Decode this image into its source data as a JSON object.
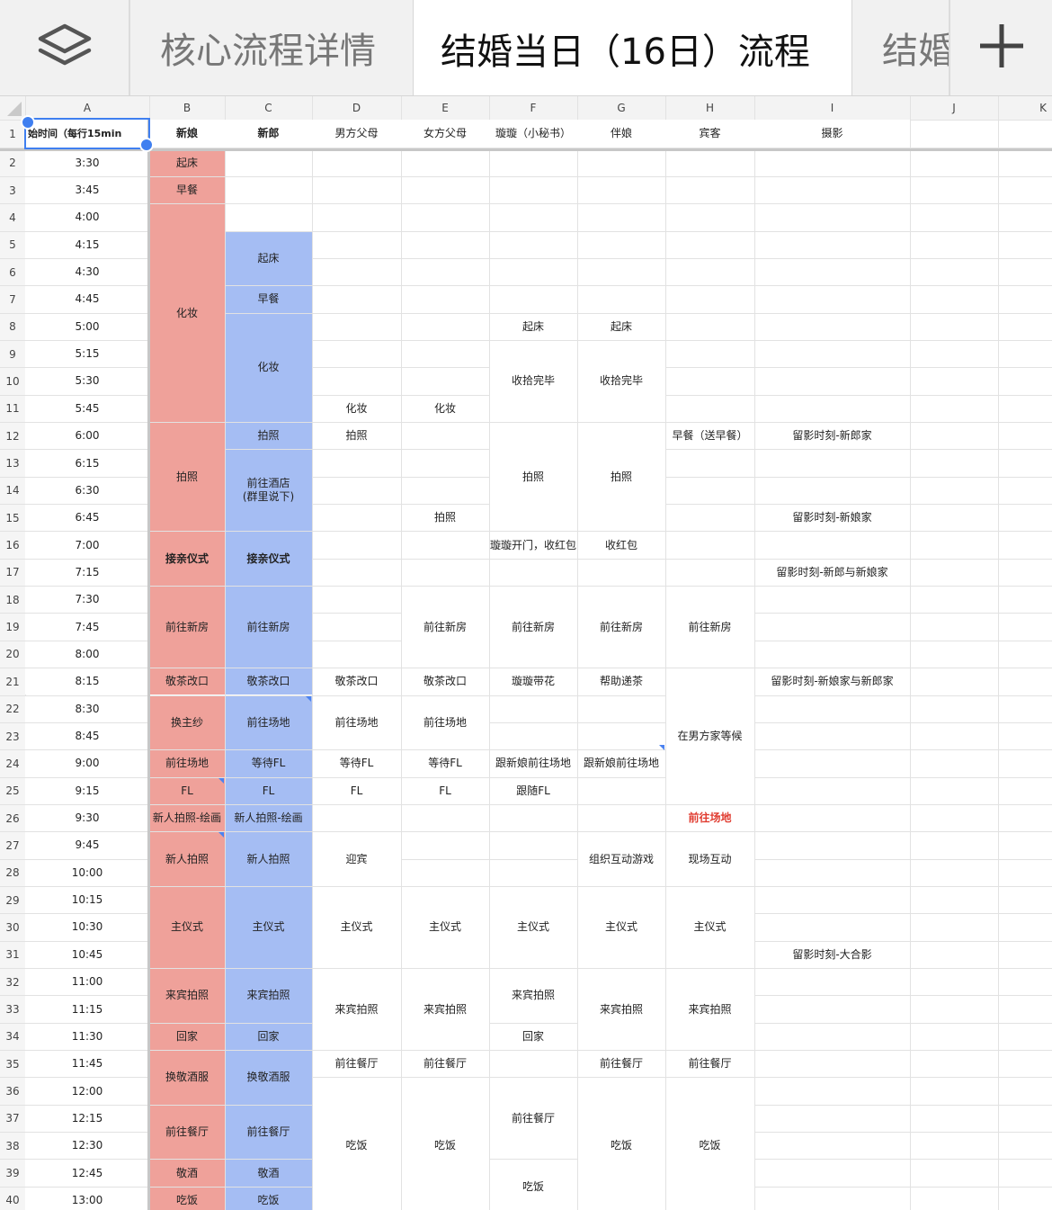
{
  "tabs": {
    "items": [
      {
        "label": "核心流程详情"
      },
      {
        "label": "结婚当日（16日）流程"
      },
      {
        "label": "结婚"
      }
    ],
    "active_index": 1,
    "layers_icon": "layers-icon",
    "add_icon": "plus-icon"
  },
  "colors": {
    "bride": "#efa19a",
    "groom": "#a5bdf3",
    "grid": "#e2e2e2",
    "header_bg": "#f3f3f3",
    "accent": "#3f7ff0",
    "alert": "#e03b2f"
  },
  "columns": [
    "A",
    "B",
    "C",
    "D",
    "E",
    "F",
    "G",
    "H",
    "I",
    "J",
    "K"
  ],
  "row_numbers": [
    "1",
    "2",
    "3",
    "4",
    "5",
    "6",
    "7",
    "8",
    "9",
    "10",
    "11",
    "12",
    "13",
    "14",
    "15",
    "16",
    "17",
    "18",
    "19",
    "20",
    "21",
    "22",
    "23",
    "24",
    "25",
    "26",
    "27",
    "28",
    "29",
    "30",
    "31",
    "32",
    "33",
    "34",
    "35",
    "36",
    "37",
    "38",
    "39",
    "40"
  ],
  "headers": [
    "始时间（每行15min",
    "新娘",
    "新郎",
    "男方父母",
    "女方父母",
    "璇璇（小秘书）",
    "伴娘",
    "宾客",
    "摄影"
  ],
  "times": [
    "3:30",
    "3:45",
    "4:00",
    "4:15",
    "4:30",
    "4:45",
    "5:00",
    "5:15",
    "5:30",
    "5:45",
    "6:00",
    "6:15",
    "6:30",
    "6:45",
    "7:00",
    "7:15",
    "7:30",
    "7:45",
    "8:00",
    "8:15",
    "8:30",
    "8:45",
    "9:00",
    "9:15",
    "9:30",
    "9:45",
    "10:00",
    "10:15",
    "10:30",
    "10:45",
    "11:00",
    "11:15",
    "11:30",
    "11:45",
    "12:00",
    "12:15",
    "12:30",
    "12:45",
    "13:00"
  ],
  "cells": [
    {
      "col": 1,
      "row": 2,
      "span": 1,
      "text": "起床",
      "fill": "bride"
    },
    {
      "col": 1,
      "row": 3,
      "span": 1,
      "text": "早餐",
      "fill": "bride"
    },
    {
      "col": 1,
      "row": 4,
      "span": 8,
      "text": "化妆",
      "fill": "bride"
    },
    {
      "col": 1,
      "row": 12,
      "span": 4,
      "text": "拍照",
      "fill": "bride"
    },
    {
      "col": 1,
      "row": 16,
      "span": 2,
      "text": "接亲仪式",
      "fill": "bride",
      "bold": true
    },
    {
      "col": 1,
      "row": 18,
      "span": 3,
      "text": "前往新房",
      "fill": "bride"
    },
    {
      "col": 1,
      "row": 21,
      "span": 1,
      "text": "敬茶改口",
      "fill": "bride"
    },
    {
      "col": 1,
      "row": 22,
      "span": 2,
      "text": "换主纱",
      "fill": "bride"
    },
    {
      "col": 1,
      "row": 24,
      "span": 1,
      "text": "前往场地",
      "fill": "bride"
    },
    {
      "col": 1,
      "row": 25,
      "span": 1,
      "text": "FL",
      "fill": "bride",
      "note": true
    },
    {
      "col": 1,
      "row": 26,
      "span": 1,
      "text": "新人拍照-绘画",
      "fill": "bride"
    },
    {
      "col": 1,
      "row": 27,
      "span": 2,
      "text": "新人拍照",
      "fill": "bride",
      "note": true
    },
    {
      "col": 1,
      "row": 29,
      "span": 3,
      "text": "主仪式",
      "fill": "bride"
    },
    {
      "col": 1,
      "row": 32,
      "span": 2,
      "text": "来宾拍照",
      "fill": "bride"
    },
    {
      "col": 1,
      "row": 34,
      "span": 1,
      "text": "回家",
      "fill": "bride"
    },
    {
      "col": 1,
      "row": 35,
      "span": 2,
      "text": "换敬酒服",
      "fill": "bride"
    },
    {
      "col": 1,
      "row": 37,
      "span": 2,
      "text": "前往餐厅",
      "fill": "bride"
    },
    {
      "col": 1,
      "row": 39,
      "span": 1,
      "text": "敬酒",
      "fill": "bride"
    },
    {
      "col": 1,
      "row": 40,
      "span": 1,
      "text": "吃饭",
      "fill": "bride"
    },
    {
      "col": 2,
      "row": 5,
      "span": 2,
      "text": "起床",
      "fill": "groom"
    },
    {
      "col": 2,
      "row": 7,
      "span": 1,
      "text": "早餐",
      "fill": "groom"
    },
    {
      "col": 2,
      "row": 8,
      "span": 4,
      "text": "化妆",
      "fill": "groom"
    },
    {
      "col": 2,
      "row": 12,
      "span": 1,
      "text": "拍照",
      "fill": "groom"
    },
    {
      "col": 2,
      "row": 13,
      "span": 3,
      "text": "前往酒店\n(群里说下)",
      "fill": "groom"
    },
    {
      "col": 2,
      "row": 16,
      "span": 2,
      "text": "接亲仪式",
      "fill": "groom",
      "bold": true
    },
    {
      "col": 2,
      "row": 18,
      "span": 3,
      "text": "前往新房",
      "fill": "groom"
    },
    {
      "col": 2,
      "row": 21,
      "span": 1,
      "text": "敬茶改口",
      "fill": "groom"
    },
    {
      "col": 2,
      "row": 22,
      "span": 2,
      "text": "前往场地",
      "fill": "groom",
      "note": true
    },
    {
      "col": 2,
      "row": 24,
      "span": 1,
      "text": "等待FL",
      "fill": "groom"
    },
    {
      "col": 2,
      "row": 25,
      "span": 1,
      "text": "FL",
      "fill": "groom"
    },
    {
      "col": 2,
      "row": 26,
      "span": 1,
      "text": "新人拍照-绘画",
      "fill": "groom"
    },
    {
      "col": 2,
      "row": 27,
      "span": 2,
      "text": "新人拍照",
      "fill": "groom"
    },
    {
      "col": 2,
      "row": 29,
      "span": 3,
      "text": "主仪式",
      "fill": "groom"
    },
    {
      "col": 2,
      "row": 32,
      "span": 2,
      "text": "来宾拍照",
      "fill": "groom"
    },
    {
      "col": 2,
      "row": 34,
      "span": 1,
      "text": "回家",
      "fill": "groom"
    },
    {
      "col": 2,
      "row": 35,
      "span": 2,
      "text": "换敬酒服",
      "fill": "groom"
    },
    {
      "col": 2,
      "row": 37,
      "span": 2,
      "text": "前往餐厅",
      "fill": "groom"
    },
    {
      "col": 2,
      "row": 39,
      "span": 1,
      "text": "敬酒",
      "fill": "groom"
    },
    {
      "col": 2,
      "row": 40,
      "span": 1,
      "text": "吃饭",
      "fill": "groom"
    },
    {
      "col": 3,
      "row": 11,
      "span": 1,
      "text": "化妆"
    },
    {
      "col": 3,
      "row": 12,
      "span": 1,
      "text": "拍照"
    },
    {
      "col": 3,
      "row": 21,
      "span": 1,
      "text": "敬茶改口"
    },
    {
      "col": 3,
      "row": 22,
      "span": 2,
      "text": "前往场地"
    },
    {
      "col": 3,
      "row": 24,
      "span": 1,
      "text": "等待FL"
    },
    {
      "col": 3,
      "row": 25,
      "span": 1,
      "text": "FL"
    },
    {
      "col": 3,
      "row": 27,
      "span": 2,
      "text": "迎宾"
    },
    {
      "col": 3,
      "row": 29,
      "span": 3,
      "text": "主仪式"
    },
    {
      "col": 3,
      "row": 32,
      "span": 3,
      "text": "来宾拍照"
    },
    {
      "col": 3,
      "row": 35,
      "span": 1,
      "text": "前往餐厅"
    },
    {
      "col": 3,
      "row": 36,
      "span": 5,
      "text": "吃饭"
    },
    {
      "col": 4,
      "row": 11,
      "span": 1,
      "text": "化妆"
    },
    {
      "col": 4,
      "row": 15,
      "span": 1,
      "text": "拍照"
    },
    {
      "col": 4,
      "row": 18,
      "span": 3,
      "text": "前往新房"
    },
    {
      "col": 4,
      "row": 21,
      "span": 1,
      "text": "敬茶改口"
    },
    {
      "col": 4,
      "row": 22,
      "span": 2,
      "text": "前往场地"
    },
    {
      "col": 4,
      "row": 24,
      "span": 1,
      "text": "等待FL"
    },
    {
      "col": 4,
      "row": 25,
      "span": 1,
      "text": "FL"
    },
    {
      "col": 4,
      "row": 29,
      "span": 3,
      "text": "主仪式"
    },
    {
      "col": 4,
      "row": 32,
      "span": 3,
      "text": "来宾拍照"
    },
    {
      "col": 4,
      "row": 35,
      "span": 1,
      "text": "前往餐厅"
    },
    {
      "col": 4,
      "row": 36,
      "span": 5,
      "text": "吃饭"
    },
    {
      "col": 5,
      "row": 8,
      "span": 1,
      "text": "起床"
    },
    {
      "col": 5,
      "row": 9,
      "span": 3,
      "text": "收拾完毕"
    },
    {
      "col": 5,
      "row": 12,
      "span": 4,
      "text": "拍照"
    },
    {
      "col": 5,
      "row": 16,
      "span": 1,
      "text": "璇璇开门，收红包"
    },
    {
      "col": 5,
      "row": 18,
      "span": 3,
      "text": "前往新房"
    },
    {
      "col": 5,
      "row": 21,
      "span": 1,
      "text": "璇璇带花"
    },
    {
      "col": 5,
      "row": 24,
      "span": 1,
      "text": "跟新娘前往场地"
    },
    {
      "col": 5,
      "row": 25,
      "span": 1,
      "text": "跟随FL"
    },
    {
      "col": 5,
      "row": 29,
      "span": 3,
      "text": "主仪式"
    },
    {
      "col": 5,
      "row": 32,
      "span": 2,
      "text": "来宾拍照"
    },
    {
      "col": 5,
      "row": 34,
      "span": 1,
      "text": "回家"
    },
    {
      "col": 5,
      "row": 36,
      "span": 3,
      "text": "前往餐厅"
    },
    {
      "col": 5,
      "row": 39,
      "span": 2,
      "text": "吃饭"
    },
    {
      "col": 6,
      "row": 8,
      "span": 1,
      "text": "起床"
    },
    {
      "col": 6,
      "row": 9,
      "span": 3,
      "text": "收拾完毕"
    },
    {
      "col": 6,
      "row": 12,
      "span": 4,
      "text": "拍照"
    },
    {
      "col": 6,
      "row": 16,
      "span": 1,
      "text": "收红包"
    },
    {
      "col": 6,
      "row": 18,
      "span": 3,
      "text": "前往新房"
    },
    {
      "col": 6,
      "row": 21,
      "span": 1,
      "text": "帮助递茶"
    },
    {
      "col": 6,
      "row": 24,
      "span": 1,
      "text": "跟新娘前往场地"
    },
    {
      "col": 6,
      "row": 27,
      "span": 2,
      "text": "组织互动游戏"
    },
    {
      "col": 6,
      "row": 29,
      "span": 3,
      "text": "主仪式"
    },
    {
      "col": 6,
      "row": 32,
      "span": 3,
      "text": "来宾拍照"
    },
    {
      "col": 6,
      "row": 35,
      "span": 1,
      "text": "前往餐厅"
    },
    {
      "col": 6,
      "row": 36,
      "span": 5,
      "text": "吃饭"
    },
    {
      "col": 7,
      "row": 12,
      "span": 1,
      "text": "早餐（送早餐）"
    },
    {
      "col": 7,
      "row": 18,
      "span": 3,
      "text": "前往新房"
    },
    {
      "col": 7,
      "row": 21,
      "span": 5,
      "text": "在男方家等候"
    },
    {
      "col": 7,
      "row": 26,
      "span": 1,
      "text": "前往场地",
      "red": true
    },
    {
      "col": 7,
      "row": 27,
      "span": 2,
      "text": "现场互动"
    },
    {
      "col": 7,
      "row": 29,
      "span": 3,
      "text": "主仪式"
    },
    {
      "col": 7,
      "row": 32,
      "span": 3,
      "text": "来宾拍照"
    },
    {
      "col": 7,
      "row": 35,
      "span": 1,
      "text": "前往餐厅"
    },
    {
      "col": 7,
      "row": 36,
      "span": 5,
      "text": "吃饭"
    },
    {
      "col": 8,
      "row": 12,
      "span": 1,
      "text": "留影时刻-新郎家"
    },
    {
      "col": 8,
      "row": 15,
      "span": 1,
      "text": "留影时刻-新娘家"
    },
    {
      "col": 8,
      "row": 17,
      "span": 1,
      "text": "留影时刻-新郎与新娘家"
    },
    {
      "col": 8,
      "row": 21,
      "span": 1,
      "text": "留影时刻-新娘家与新郎家"
    },
    {
      "col": 8,
      "row": 31,
      "span": 1,
      "text": "留影时刻-大合影"
    }
  ],
  "notes_extra": [
    {
      "col": 6,
      "row": 23
    }
  ]
}
